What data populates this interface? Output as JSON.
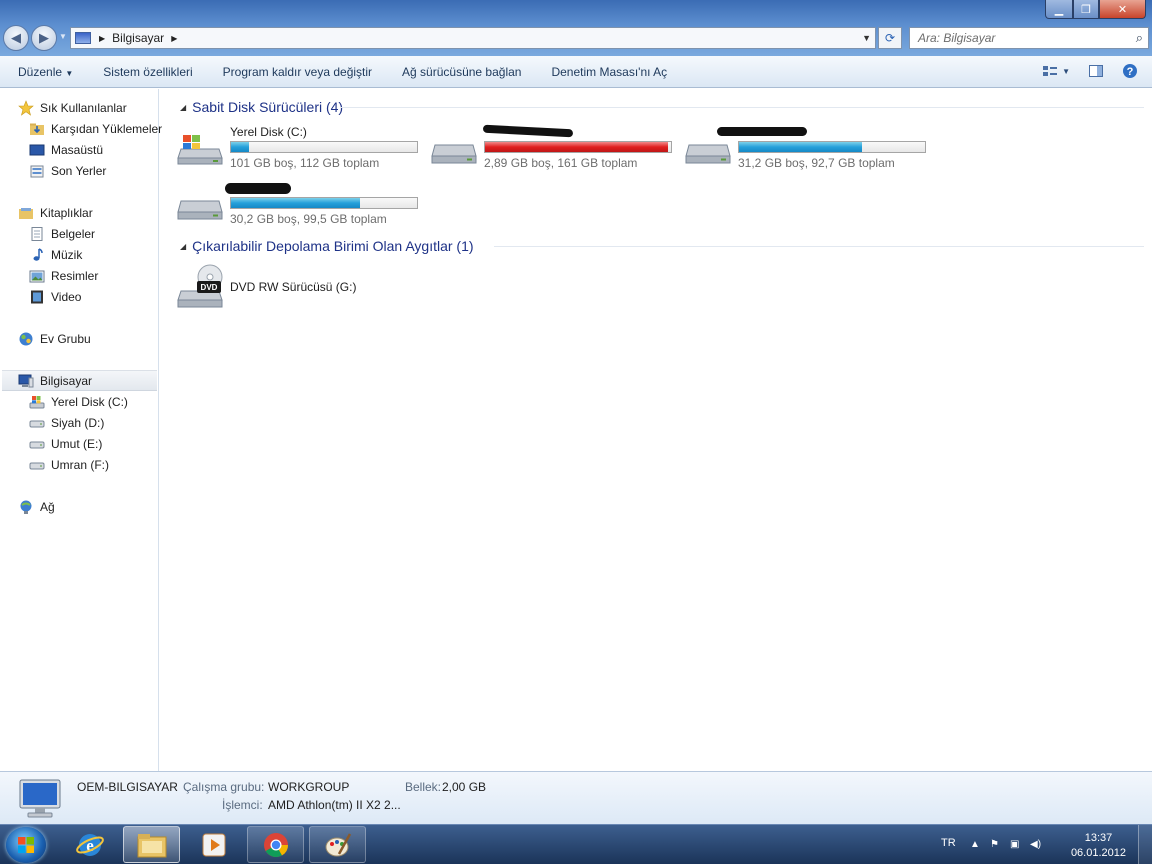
{
  "window": {
    "min_glyph": "▁",
    "max_glyph": "❐",
    "close_glyph": "✕"
  },
  "nav": {
    "back_glyph": "◀",
    "forward_glyph": "▶",
    "dropdown_glyph": "▼"
  },
  "address": {
    "crumb": "Bilgisayar",
    "refresh_glyph": "⟳"
  },
  "search": {
    "placeholder": "Ara: Bilgisayar",
    "icon": "search-icon"
  },
  "commandbar": {
    "items": [
      "Düzenle",
      "Sistem özellikleri",
      "Program kaldır veya değiştir",
      "Ağ sürücüsüne bağlan",
      "Denetim Masası'nı Aç"
    ],
    "organize_arrow": "▼"
  },
  "sidebar": {
    "favorites_header": "Sık Kullanılanlar",
    "favorites": [
      "Karşıdan Yüklemeler",
      "Masaüstü",
      "Son Yerler"
    ],
    "libraries_header": "Kitaplıklar",
    "libraries": [
      "Belgeler",
      "Müzik",
      "Resimler",
      "Video"
    ],
    "homegroup": "Ev Grubu",
    "computer_header": "Bilgisayar",
    "drives": [
      "Yerel Disk (C:)",
      "Siyah (D:)",
      "Umut (E:)",
      "Umran (F:)"
    ],
    "network": "Ağ"
  },
  "groups": {
    "hdd_title": "Sabit Disk Sürücüleri (4)",
    "removable_title": "Çıkarılabilir Depolama Birimi Olan Aygıtlar (1)"
  },
  "drives": [
    {
      "name": "Yerel Disk (C:)",
      "info": "101 GB boş, 112 GB toplam",
      "used_fraction": 0.098,
      "color": "#26a0da"
    },
    {
      "name": "",
      "info": "2,89 GB boş, 161 GB toplam",
      "used_fraction": 0.982,
      "color": "#e02020"
    },
    {
      "name": "",
      "info": "31,2 GB boş, 92,7 GB toplam",
      "used_fraction": 0.663,
      "color": "#26a0da"
    },
    {
      "name": "",
      "info": "30,2 GB boş, 99,5 GB toplam",
      "used_fraction": 0.696,
      "color": "#26a0da"
    }
  ],
  "dvd": {
    "name": "DVD RW Sürücüsü (G:)",
    "badge": "DVD"
  },
  "details": {
    "computer_name": "OEM-BILGISAYAR",
    "workgroup_label": "Çalışma grubu:",
    "workgroup_value": "WORKGROUP",
    "memory_label": "Bellek:",
    "memory_value": "2,00 GB",
    "cpu_label": "İşlemci:",
    "cpu_value": "AMD Athlon(tm) II X2 2..."
  },
  "taskbar": {
    "lang": "TR",
    "time": "13:37",
    "date": "06.01.2012"
  }
}
